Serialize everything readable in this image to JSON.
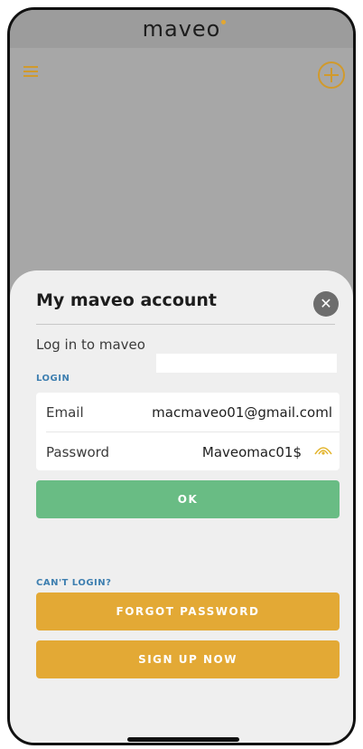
{
  "app": {
    "logo_text": "maveo"
  },
  "colors": {
    "accent": "#e3a935",
    "ok": "#69bc84",
    "link_blue": "#3e7fb0"
  },
  "icons": {
    "menu": "hamburger-menu-icon",
    "add": "plus-circle-icon",
    "close": "close-icon",
    "visibility": "eye-icon"
  },
  "sheet": {
    "title": "My maveo account",
    "close_symbol": "✕",
    "subtitle": "Log in to maveo",
    "login_section_label": "LOGIN",
    "email_label": "Email",
    "email_value": "macmaveo01@gmail.coml",
    "password_label": "Password",
    "password_value": "Maveomac01$",
    "ok_label": "OK",
    "cant_login_label": "CAN'T LOGIN?",
    "forgot_password_label": "FORGOT PASSWORD",
    "signup_label": "SIGN UP NOW"
  }
}
